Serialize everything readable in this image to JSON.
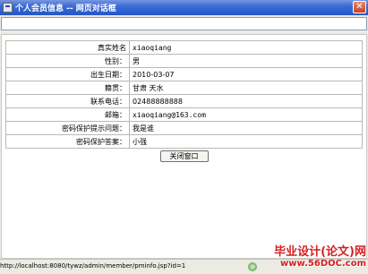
{
  "window": {
    "title": "个人会员信息  --  网页对话框",
    "close_glyph": "✕"
  },
  "address_bar": {
    "value": ""
  },
  "form": {
    "rows": [
      {
        "label": "真实姓名",
        "value": "xiaoqiang"
      },
      {
        "label": "性别：",
        "value": "男"
      },
      {
        "label": "出生日期：",
        "value": "2010-03-07"
      },
      {
        "label": "籍贯：",
        "value": "甘肃 天水"
      },
      {
        "label": "联系电话：",
        "value": "02488888888"
      },
      {
        "label": "邮箱：",
        "value": "xiaoqiang@163.com"
      },
      {
        "label": "密码保护提示问题：",
        "value": "我是谁"
      },
      {
        "label": "密码保护答案：",
        "value": "小强"
      }
    ],
    "close_button_label": "关闭窗口"
  },
  "status_bar": {
    "url": "http://localhost:8080/tywz/admin/member/pminfo.jsp?id=1"
  },
  "watermark": {
    "line1": "毕业设计(论文)网",
    "line2": "www.56DOC.com"
  },
  "icons": {
    "app": "dialog-app-icon",
    "close": "close-icon",
    "status": "ie-page-icon",
    "zone": "internet-zone-icon"
  }
}
